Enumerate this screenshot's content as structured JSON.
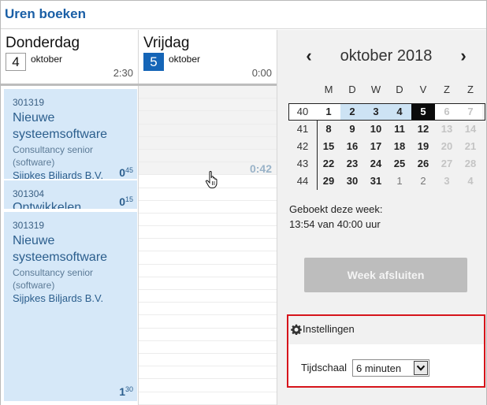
{
  "header": {
    "title": "Uren boeken"
  },
  "days": [
    {
      "name": "Donderdag",
      "number": "4",
      "month": "oktober",
      "total": "2:30"
    },
    {
      "name": "Vrijdag",
      "number": "5",
      "month": "oktober",
      "total": "0:00"
    }
  ],
  "entries": [
    {
      "code": "301319",
      "description": "Nieuwe systeemsoftware",
      "role": "Consultancy senior (software)",
      "client": "Sijpkes Biljards B.V.",
      "duration_hours": "0",
      "duration_minutes": "45"
    },
    {
      "code": "301304",
      "description": "Ontwikkelen",
      "duration_hours": "0",
      "duration_minutes": "15"
    },
    {
      "code": "301319",
      "description": "Nieuwe systeemsoftware",
      "role": "Consultancy senior (software)",
      "client": "Sijpkes Biljards B.V.",
      "duration_hours": "1",
      "duration_minutes": "30"
    }
  ],
  "friday_block": {
    "duration": "0:42"
  },
  "calendar": {
    "month_label": "oktober 2018",
    "weekday_headers": [
      "M",
      "D",
      "W",
      "D",
      "V",
      "Z",
      "Z"
    ],
    "weeks": [
      {
        "week": "40",
        "days": [
          "1",
          "2",
          "3",
          "4",
          "5",
          "6",
          "7"
        ]
      },
      {
        "week": "41",
        "days": [
          "8",
          "9",
          "10",
          "11",
          "12",
          "13",
          "14"
        ]
      },
      {
        "week": "42",
        "days": [
          "15",
          "16",
          "17",
          "18",
          "19",
          "20",
          "21"
        ]
      },
      {
        "week": "43",
        "days": [
          "22",
          "23",
          "24",
          "25",
          "26",
          "27",
          "28"
        ]
      },
      {
        "week": "44",
        "days": [
          "29",
          "30",
          "31",
          "1",
          "2",
          "3",
          "4"
        ]
      }
    ]
  },
  "booked": {
    "label": "Geboekt deze week:",
    "value": "13:54 van 40:00 uur"
  },
  "week_button": {
    "label": "Week afsluiten"
  },
  "settings": {
    "title": "Instellingen",
    "scale_label": "Tijdschaal",
    "scale_value": "6 minuten"
  },
  "colors": {
    "accent": "#1565b7",
    "title": "#1a5fa6",
    "entry_bg": "#d6e8f8",
    "highlight_border": "#d6141b",
    "disabled_button": "#bdbdbd"
  }
}
